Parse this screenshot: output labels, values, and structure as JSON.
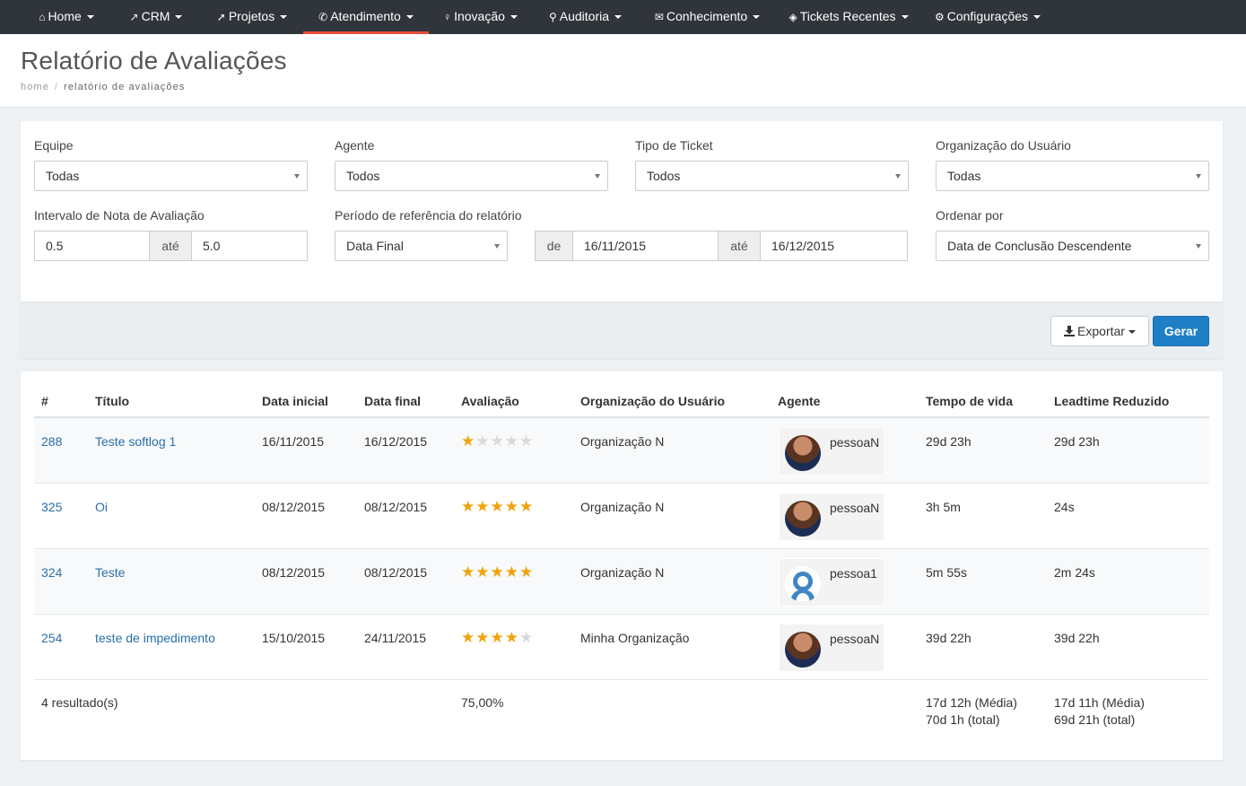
{
  "nav": {
    "items": [
      {
        "label": "Home",
        "icon": "home-icon",
        "glyph": "⌂"
      },
      {
        "label": "CRM",
        "icon": "chart-line-icon",
        "glyph": "↗"
      },
      {
        "label": "Projetos",
        "icon": "rocket-icon",
        "glyph": "➚"
      },
      {
        "label": "Atendimento",
        "icon": "phone-icon",
        "glyph": "✆"
      },
      {
        "label": "Inovação",
        "icon": "lightbulb-icon",
        "glyph": "♀"
      },
      {
        "label": "Auditoria",
        "icon": "search-icon",
        "glyph": "⚲"
      },
      {
        "label": "Conhecimento",
        "icon": "comments-icon",
        "glyph": "✉"
      },
      {
        "label": "Tickets Recentes",
        "icon": "tags-icon",
        "glyph": "◈"
      },
      {
        "label": "Configurações",
        "icon": "gear-icon",
        "glyph": "⚙"
      }
    ],
    "active_index": 3
  },
  "header": {
    "title": "Relatório de Avaliações",
    "breadcrumb_home": "home",
    "breadcrumb_sep": "/",
    "breadcrumb_current": "relatório de avaliações"
  },
  "filters": {
    "equipe_label": "Equipe",
    "equipe_value": "Todas",
    "agente_label": "Agente",
    "agente_value": "Todos",
    "tipo_label": "Tipo de Ticket",
    "tipo_value": "Todos",
    "org_label": "Organização do Usuário",
    "org_value": "Todas",
    "nota_label": "Intervalo de Nota de Avaliação",
    "nota_min": "0.5",
    "nota_ate": "até",
    "nota_max": "5.0",
    "periodo_label": "Período de referência do relatório",
    "periodo_value": "Data Final",
    "de_label": "de",
    "data_de": "16/11/2015",
    "data_ate_label": "até",
    "data_ate": "16/12/2015",
    "ordenar_label": "Ordenar por",
    "ordenar_value": "Data de Conclusão Descendente",
    "export_label": "Exportar",
    "gerar_label": "Gerar"
  },
  "colors": {
    "accent": "#1f7fc6",
    "active_nav": "#e74c3c",
    "star": "#f0a30a",
    "link": "#2a6faa"
  },
  "table": {
    "headers": [
      "#",
      "Título",
      "Data inicial",
      "Data final",
      "Avaliação",
      "Organização do Usuário",
      "Agente",
      "Tempo de vida",
      "Leadtime Reduzido"
    ],
    "rows": [
      {
        "id": "288",
        "title": "Teste softlog 1",
        "start": "16/11/2015",
        "end": "16/12/2015",
        "rating": 1,
        "org": "Organização N",
        "agent": "pessoaN",
        "avatar": "photo",
        "lifetime": "29d 23h",
        "leadtime": "29d 23h"
      },
      {
        "id": "325",
        "title": "Oi",
        "start": "08/12/2015",
        "end": "08/12/2015",
        "rating": 5,
        "org": "Organização N",
        "agent": "pessoaN",
        "avatar": "photo",
        "lifetime": "3h 5m",
        "leadtime": "24s"
      },
      {
        "id": "324",
        "title": "Teste",
        "start": "08/12/2015",
        "end": "08/12/2015",
        "rating": 5,
        "org": "Organização N",
        "agent": "pessoa1",
        "avatar": "default",
        "lifetime": "5m 55s",
        "leadtime": "2m 24s"
      },
      {
        "id": "254",
        "title": "teste de impedimento",
        "start": "15/10/2015",
        "end": "24/11/2015",
        "rating": 4,
        "org": "Minha Organização",
        "agent": "pessoaN",
        "avatar": "photo",
        "lifetime": "39d 22h",
        "leadtime": "39d 22h"
      }
    ],
    "summary": {
      "count": "4 resultado(s)",
      "avg_rating": "75,00%",
      "lifetime_avg": "17d 12h (Média)",
      "lifetime_total": "70d 1h (total)",
      "leadtime_avg": "17d 11h (Média)",
      "leadtime_total": "69d 21h (total)"
    }
  }
}
